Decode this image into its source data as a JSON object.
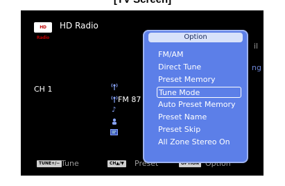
{
  "caption": "[TV Screen]",
  "screen": {
    "logo_text": "HD Radio",
    "title": "HD Radio",
    "channel": "CH 1",
    "frequency": "FM 87",
    "edge_right_1": "il",
    "edge_right_2": "ng"
  },
  "option_menu": {
    "header": "Option",
    "items": [
      {
        "label": "FM/AM"
      },
      {
        "label": "Direct Tune"
      },
      {
        "label": "Preset Memory"
      },
      {
        "label": "Tune Mode"
      },
      {
        "label": "Auto Preset Memory"
      },
      {
        "label": "Preset Name"
      },
      {
        "label": "Preset Skip"
      },
      {
        "label": "All Zone Stereo On"
      }
    ],
    "selected_index": 3
  },
  "bottom_bar": {
    "tune_badge": "TUNE+/−",
    "tune_label": "Tune",
    "ch_badge": "CH▲/▼",
    "preset_label": "Preset",
    "option_badge": "OPTION",
    "option_label": "Option"
  },
  "icons": {
    "antenna": "antenna-icon",
    "antenna2": "antenna-icon",
    "music": "music-note-icon",
    "person": "person-icon",
    "text_info": "text-info-icon"
  },
  "colors": {
    "panel_bg": "#5c7fe8",
    "panel_header": "#d8e2fa",
    "screen_bg": "#000000"
  }
}
